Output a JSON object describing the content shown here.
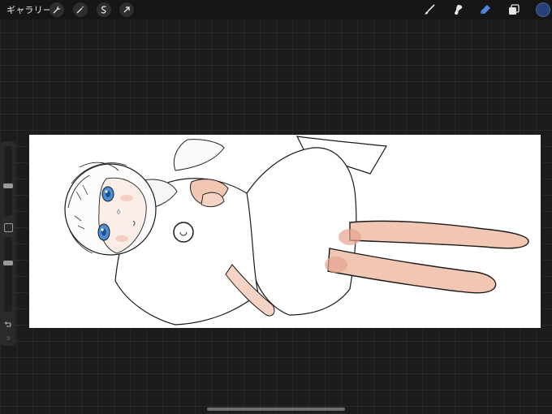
{
  "topbar": {
    "gallery_label": "ギャラリー",
    "left_tools": [
      "wrench-icon",
      "magic-wand-icon",
      "selection-icon",
      "transform-arrow-icon"
    ],
    "right_tools": [
      "brush-icon",
      "smudge-icon",
      "eraser-icon",
      "layers-icon"
    ],
    "accent_color": "#4f86d8",
    "current_color": "#27417a"
  },
  "sidebar": {
    "brush_size_level": 0.42,
    "opacity_level": 0.66
  },
  "canvas": {
    "background": "#ffffff",
    "skin_tone": "#f1c7b4",
    "eye_color": "#4a8fd6"
  }
}
